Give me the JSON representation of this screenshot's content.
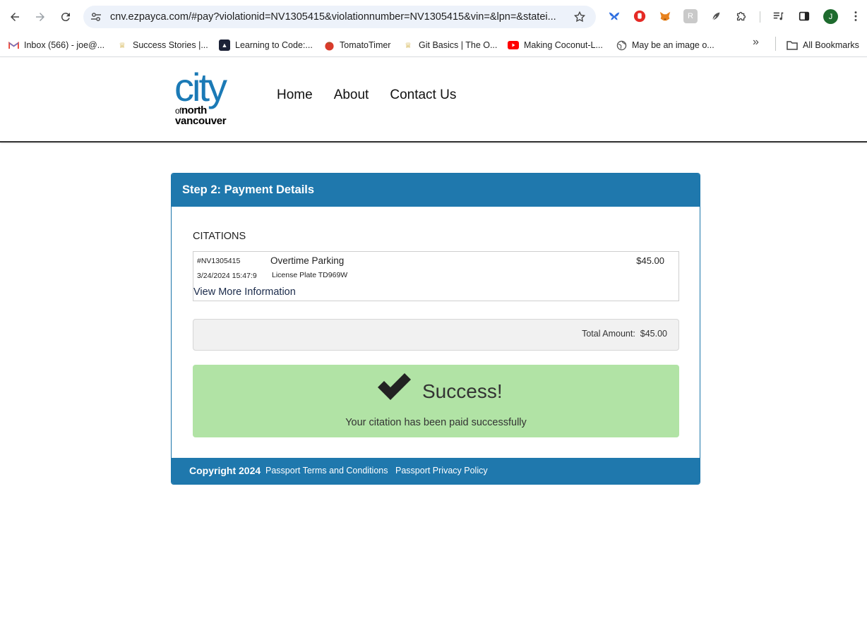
{
  "browser": {
    "url": "cnv.ezpayca.com/#pay?violationid=NV1305415&violationnumber=NV1305415&vin=&lpn=&statei...",
    "avatar_letter": "J",
    "bookmarks": [
      {
        "label": "Inbox (566) - joe@...",
        "icon": "gmail-icon"
      },
      {
        "label": "Success Stories |...",
        "icon": "trophy-icon"
      },
      {
        "label": "Learning to Code:...",
        "icon": "code-icon"
      },
      {
        "label": "TomatoTimer",
        "icon": "tomato-icon"
      },
      {
        "label": "Git Basics | The O...",
        "icon": "trophy-icon"
      },
      {
        "label": "Making Coconut-L...",
        "icon": "youtube-icon"
      },
      {
        "label": "May be an image o...",
        "icon": "globe-icon"
      }
    ],
    "all_bookmarks": "All Bookmarks"
  },
  "site": {
    "logo": {
      "line1": "city",
      "line2_small": "of",
      "line2": "north",
      "line3": "vancouver"
    },
    "nav": [
      "Home",
      "About",
      "Contact Us"
    ]
  },
  "card": {
    "heading": "Step 2: Payment Details",
    "citations_title": "CITATIONS",
    "citation": {
      "id": "#NV1305415",
      "description": "Overtime Parking",
      "amount": "$45.00",
      "date": "3/24/2024 15:47:9",
      "plate": "License Plate TD969W",
      "view_more": "View More Information"
    },
    "total": "Total Amount:  $45.00",
    "success_title": "Success!",
    "success_message": "Your citation has been paid successfully",
    "footer": {
      "copyright": "Copyright 2024",
      "terms": "Passport Terms and Conditions",
      "privacy": "Passport Privacy Policy"
    }
  },
  "colors": {
    "brand_blue": "#1f78ad",
    "success_green": "#b1e3a5",
    "logo_blue": "#1b7ab6"
  }
}
